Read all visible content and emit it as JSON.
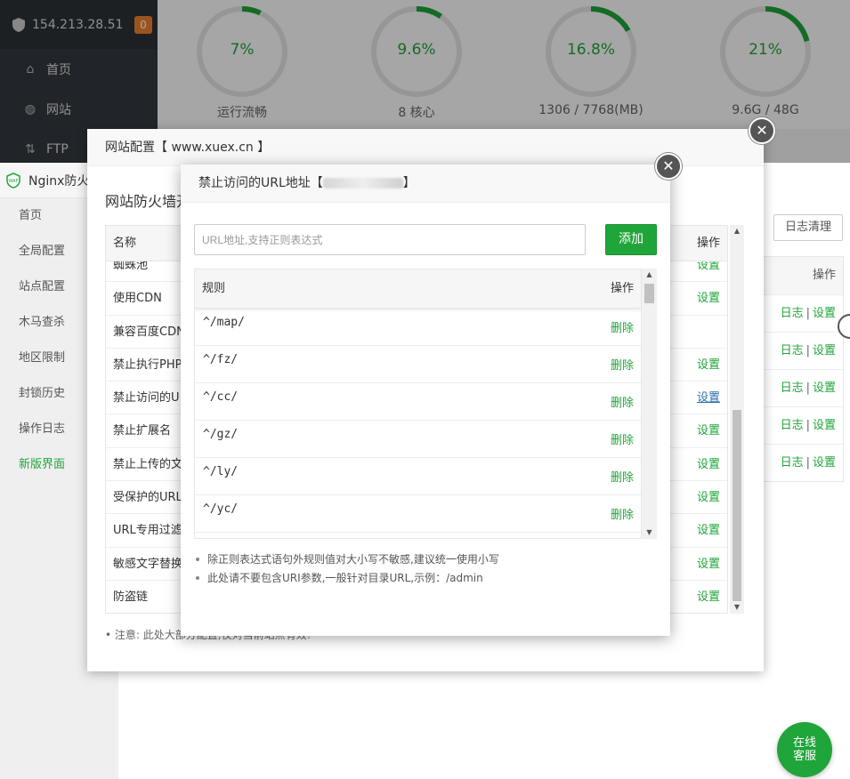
{
  "sidebar": {
    "ip": "154.213.28.51",
    "badge": "0",
    "items": [
      {
        "label": "首页",
        "icon": "home-icon"
      },
      {
        "label": "网站",
        "icon": "globe-icon"
      },
      {
        "label": "FTP",
        "icon": "ftp-icon"
      }
    ]
  },
  "gauges": [
    {
      "value": "7%",
      "label": "运行流畅",
      "fraction": 0.07
    },
    {
      "value": "9.6%",
      "label": "8 核心",
      "fraction": 0.096
    },
    {
      "value": "16.8%",
      "label": "1306 / 7768(MB)",
      "fraction": 0.168
    },
    {
      "value": "21%",
      "label": "9.6G / 48G",
      "fraction": 0.21
    }
  ],
  "firewall": {
    "title": "Nginx防火",
    "nav": [
      "首页",
      "全局配置",
      "站点配置",
      "木马查杀",
      "地区限制",
      "封锁历史",
      "操作日志",
      "新版界面"
    ],
    "clear_log_label": "日志清理",
    "op_header": "操作",
    "row_actions": [
      {
        "log": "日志",
        "sep": "|",
        "set": "设置"
      },
      {
        "log": "日志",
        "sep": "|",
        "set": "设置"
      },
      {
        "log": "日志",
        "sep": "|",
        "set": "设置"
      },
      {
        "log": "日志",
        "sep": "|",
        "set": "设置"
      },
      {
        "log": "日志",
        "sep": "|",
        "set": "设置"
      }
    ]
  },
  "site_config": {
    "title": "网站配置【 www.xuex.cn 】",
    "subtitle": "网站防火墙开",
    "col_name": "名称",
    "col_op": "操作",
    "rows": [
      {
        "name": "蜘蛛池",
        "op": "设置"
      },
      {
        "name": "使用CDN",
        "op": "设置"
      },
      {
        "name": "兼容百度CDN",
        "op": ""
      },
      {
        "name": "禁止执行PHP",
        "op": "设置"
      },
      {
        "name": "禁止访问的U",
        "op": "设置"
      },
      {
        "name": "禁止扩展名",
        "op": "设置"
      },
      {
        "name": "禁止上传的文",
        "op": "设置"
      },
      {
        "name": "受保护的URL",
        "op": "设置"
      },
      {
        "name": "URL专用过滤",
        "op": "设置"
      },
      {
        "name": "敏感文字替换",
        "op": "设置"
      },
      {
        "name": "防盗链",
        "op": "设置"
      }
    ],
    "note": "注意: 此处大部分配置,仅对当前站点有效!"
  },
  "url_dialog": {
    "title_prefix": "禁止访问的URL地址【",
    "title_suffix": "】",
    "input_placeholder": "URL地址,支持正则表达式",
    "add_label": "添加",
    "col_rule": "规则",
    "col_op": "操作",
    "rules": [
      {
        "rule": "^/map/",
        "op": "删除"
      },
      {
        "rule": "^/fz/",
        "op": "删除"
      },
      {
        "rule": "^/cc/",
        "op": "删除"
      },
      {
        "rule": "^/gz/",
        "op": "删除"
      },
      {
        "rule": "^/ly/",
        "op": "删除"
      },
      {
        "rule": "^/yc/",
        "op": "删除"
      }
    ],
    "tips": [
      "除正则表达式语句外规则值对大小写不敏感,建议统一使用小写",
      "此处请不要包含URI参数,一般针对目录URL,示例：/admin"
    ]
  },
  "service": {
    "line1": "在线",
    "line2": "客服"
  },
  "colors": {
    "accent": "#20a53a",
    "sidebar": "#333a40",
    "badge": "#f0812e"
  }
}
